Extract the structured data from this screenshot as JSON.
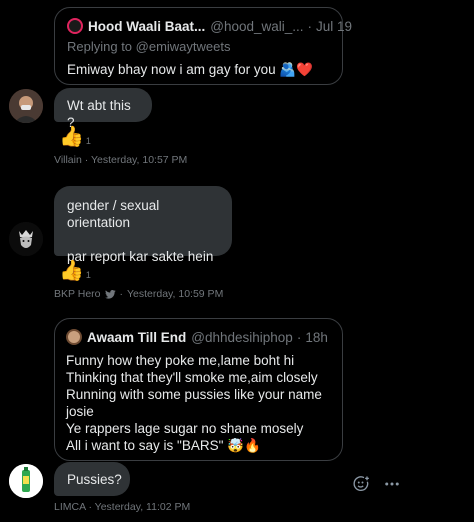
{
  "quote1": {
    "name": "Hood Waali Baat...",
    "handle": "@hood_wali_...",
    "dot": "·",
    "date": "Jul 19",
    "replying": "Replying to @emiwaytweets",
    "text": "Emiway bhay now i am gay for you",
    "emoji": "🫂❤️"
  },
  "messages": [
    {
      "sender": "Villain",
      "text": "Wt abt this ?",
      "reaction": "👍",
      "reaction_count": "1",
      "time": "Yesterday, 10:57 PM"
    },
    {
      "sender": "BKP Hero",
      "lines": [
        "gender / sexual orientation",
        "par report kar sakte hein"
      ],
      "reaction": "👍",
      "reaction_count": "1",
      "time": "Yesterday, 10:59 PM"
    },
    {
      "sender": "LIMCA",
      "text": "Pussies?",
      "time": "Yesterday, 11:02 PM"
    }
  ],
  "quote2": {
    "name": "Awaam Till End",
    "handle": "@dhhdesihiphop",
    "dot": "·",
    "date": "18h",
    "lines": [
      "Funny how they poke me,lame boht hi",
      "Thinking that they'll smoke me,aim closely",
      "Running with some pussies like your name",
      "josie",
      "Ye rappers lage sugar no shane mosely",
      "All i want to say is \"BARS\""
    ],
    "emoji": "🤯🔥"
  },
  "meta_separator": "·",
  "icons": [
    "verified-badge-icon",
    "thumbs-up-icon",
    "add-reaction-icon",
    "more-options-icon"
  ],
  "colors": {
    "background": "#000000",
    "bubble": "#2f3336",
    "border": "#3a3d41",
    "text": "#e7e9ea",
    "muted": "#71767b"
  }
}
